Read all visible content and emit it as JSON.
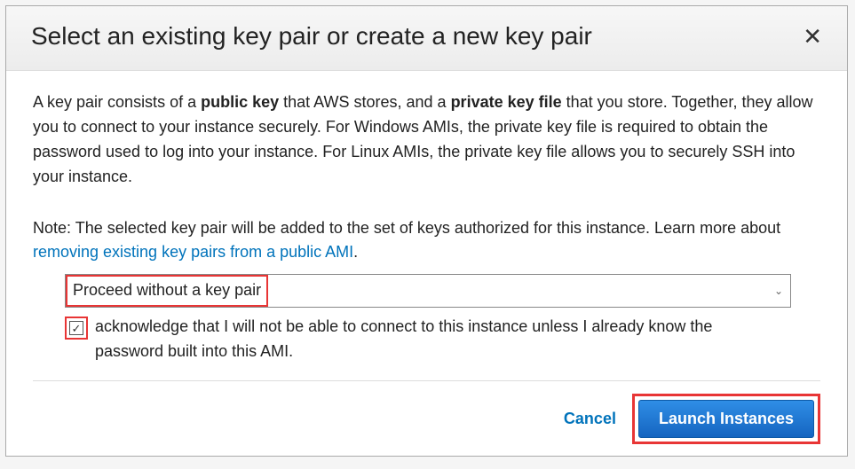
{
  "dialog": {
    "title": "Select an existing key pair or create a new key pair",
    "description_parts": {
      "a": "A key pair consists of a ",
      "b_public": "public key",
      "c": " that AWS stores, and a ",
      "d_private": "private key file",
      "e": " that you store. Together, they allow you to connect to your instance securely. For Windows AMIs, the private key file is required to obtain the password used to log into your instance. For Linux AMIs, the private key file allows you to securely SSH into your instance."
    },
    "note_parts": {
      "prefix": "Note: The selected key pair will be added to the set of keys authorized for this instance. Learn more about ",
      "link_text": "removing existing key pairs from a public AMI",
      "suffix": "."
    },
    "select": {
      "selected": "Proceed without a key pair"
    },
    "acknowledge": {
      "checked": true,
      "text": " acknowledge that I will not be able to connect to this instance unless I already know the password built into this AMI."
    },
    "footer": {
      "cancel": "Cancel",
      "launch": "Launch Instances"
    }
  }
}
